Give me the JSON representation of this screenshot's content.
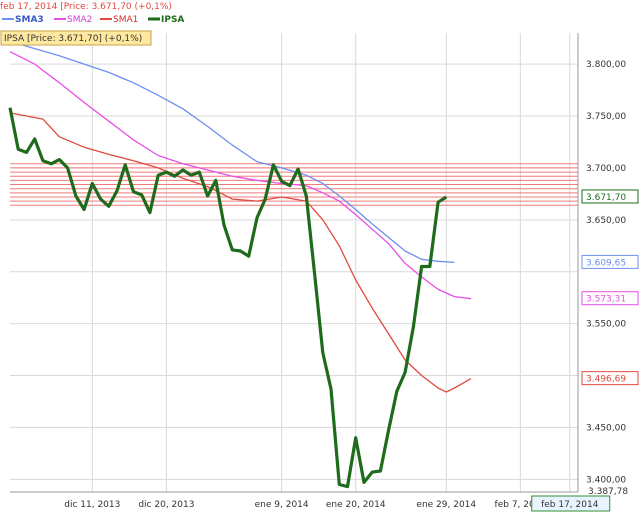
{
  "header": {
    "info_line": "feb 17, 2014 [Price: 3.671,70 (+0,1%)",
    "legend": [
      {
        "name": "SMA3",
        "color": "#6f8ff0"
      },
      {
        "name": "SMA2",
        "color": "#e64fe6"
      },
      {
        "name": "SMA1",
        "color": "#e04a3f"
      },
      {
        "name": "IPSA",
        "color": "#1f6b1c"
      }
    ],
    "price_box": "IPSA [Price: 3.671,70] (+0,1%)"
  },
  "colors": {
    "plot_bg": "#ffffff",
    "grid": "#d9d9d9",
    "band_lines": "#f07a7a",
    "axis_text": "#333333",
    "price_box_bg": "#ffe8a0"
  },
  "chart_data": {
    "type": "line",
    "x": [
      0,
      1,
      2,
      3,
      4,
      5,
      6,
      7,
      8,
      9,
      10,
      11,
      12,
      13,
      14,
      15,
      16,
      17,
      18,
      19,
      20,
      21,
      22,
      23,
      24,
      25,
      26,
      27,
      28,
      29,
      30,
      31,
      32,
      33,
      34,
      35,
      36,
      37,
      38,
      39,
      40,
      41,
      42,
      43,
      44,
      45,
      46,
      47,
      48,
      49,
      50,
      51,
      52,
      53,
      54,
      55,
      56,
      57,
      58,
      59,
      60,
      61,
      62,
      63,
      64,
      65,
      66,
      67,
      68,
      69
    ],
    "ylim": [
      3387.78,
      3830
    ],
    "yticks": [
      3400,
      3450,
      3500,
      3550,
      3600,
      3650,
      3700,
      3750,
      3800
    ],
    "ytick_labels": [
      "3.400,00",
      "3.450,00",
      "",
      "3.550,00",
      "",
      "3.650,00",
      "3.700,00",
      "3.750,00",
      "3.800,00"
    ],
    "xtick_labels": [
      {
        "pos": 10,
        "label": "dic 11, 2013"
      },
      {
        "pos": 19,
        "label": "dic 20, 2013"
      },
      {
        "pos": 33,
        "label": "ene 9, 2014"
      },
      {
        "pos": 42,
        "label": "ene 20, 2014"
      },
      {
        "pos": 53,
        "label": "ene 29, 2014"
      },
      {
        "pos": 62,
        "label": "feb 7, 2014"
      },
      {
        "pos": 68,
        "label": "feb 17, 2014"
      }
    ],
    "bottom_min_label": "3.387,78",
    "series": [
      {
        "name": "IPSA",
        "color": "#1f6b1c",
        "last_label": "3.671,70",
        "points": [
          [
            0,
            3758
          ],
          [
            1,
            3718
          ],
          [
            2,
            3715
          ],
          [
            3,
            3728
          ],
          [
            4,
            3707
          ],
          [
            5,
            3704
          ],
          [
            6,
            3708
          ],
          [
            7,
            3700
          ],
          [
            8,
            3673
          ],
          [
            9,
            3660
          ],
          [
            10,
            3685
          ],
          [
            11,
            3670
          ],
          [
            12,
            3663
          ],
          [
            13,
            3678
          ],
          [
            14,
            3703
          ],
          [
            15,
            3677
          ],
          [
            16,
            3674
          ],
          [
            17,
            3657
          ],
          [
            18,
            3693
          ],
          [
            19,
            3696
          ],
          [
            20,
            3692
          ],
          [
            21,
            3698
          ],
          [
            22,
            3693
          ],
          [
            23,
            3696
          ],
          [
            24,
            3673
          ],
          [
            25,
            3688
          ],
          [
            26,
            3645
          ],
          [
            27,
            3621
          ],
          [
            28,
            3620
          ],
          [
            29,
            3615
          ],
          [
            30,
            3652
          ],
          [
            31,
            3670
          ],
          [
            32,
            3703
          ],
          [
            33,
            3687
          ],
          [
            34,
            3683
          ],
          [
            35,
            3699
          ],
          [
            36,
            3673
          ],
          [
            37,
            3598
          ],
          [
            38,
            3522
          ],
          [
            39,
            3487
          ],
          [
            40,
            3395
          ],
          [
            41,
            3393
          ],
          [
            42,
            3440
          ],
          [
            43,
            3397
          ],
          [
            44,
            3407
          ],
          [
            45,
            3408
          ],
          [
            46,
            3448
          ],
          [
            47,
            3485
          ],
          [
            48,
            3503
          ],
          [
            49,
            3547
          ],
          [
            50,
            3605
          ],
          [
            51,
            3605
          ],
          [
            52,
            3667
          ],
          [
            53,
            3672
          ]
        ]
      },
      {
        "name": "SMA1",
        "color": "#e04a3f",
        "last_label": "3.496,69",
        "points": [
          [
            0,
            3753
          ],
          [
            4,
            3747
          ],
          [
            6,
            3730
          ],
          [
            9,
            3720
          ],
          [
            12,
            3713
          ],
          [
            15,
            3707
          ],
          [
            18,
            3700
          ],
          [
            21,
            3690
          ],
          [
            24,
            3682
          ],
          [
            27,
            3670
          ],
          [
            30,
            3668
          ],
          [
            33,
            3672
          ],
          [
            36,
            3668
          ],
          [
            38,
            3650
          ],
          [
            40,
            3625
          ],
          [
            42,
            3592
          ],
          [
            44,
            3565
          ],
          [
            46,
            3540
          ],
          [
            48,
            3515
          ],
          [
            50,
            3500
          ],
          [
            52,
            3488
          ],
          [
            53,
            3484
          ],
          [
            54,
            3488
          ],
          [
            56,
            3497
          ]
        ]
      },
      {
        "name": "SMA2",
        "color": "#e64fe6",
        "last_label": "3.573,31",
        "points": [
          [
            0,
            3812
          ],
          [
            3,
            3800
          ],
          [
            6,
            3782
          ],
          [
            9,
            3763
          ],
          [
            12,
            3745
          ],
          [
            15,
            3727
          ],
          [
            18,
            3712
          ],
          [
            21,
            3704
          ],
          [
            24,
            3698
          ],
          [
            27,
            3692
          ],
          [
            30,
            3688
          ],
          [
            33,
            3685
          ],
          [
            36,
            3683
          ],
          [
            38,
            3676
          ],
          [
            40,
            3668
          ],
          [
            42,
            3655
          ],
          [
            44,
            3641
          ],
          [
            46,
            3627
          ],
          [
            48,
            3608
          ],
          [
            50,
            3595
          ],
          [
            52,
            3583
          ],
          [
            54,
            3576
          ],
          [
            56,
            3574
          ]
        ]
      },
      {
        "name": "SMA3",
        "color": "#6f8ff0",
        "last_label": "3.609,65",
        "points": [
          [
            0,
            3822
          ],
          [
            3,
            3815
          ],
          [
            6,
            3808
          ],
          [
            9,
            3800
          ],
          [
            12,
            3792
          ],
          [
            15,
            3782
          ],
          [
            18,
            3770
          ],
          [
            21,
            3757
          ],
          [
            24,
            3740
          ],
          [
            27,
            3722
          ],
          [
            30,
            3706
          ],
          [
            33,
            3700
          ],
          [
            36,
            3693
          ],
          [
            38,
            3685
          ],
          [
            40,
            3673
          ],
          [
            42,
            3660
          ],
          [
            44,
            3646
          ],
          [
            46,
            3633
          ],
          [
            48,
            3620
          ],
          [
            50,
            3612
          ],
          [
            52,
            3610
          ],
          [
            54,
            3609
          ]
        ]
      }
    ],
    "bands": [
      3664,
      3668,
      3672,
      3676,
      3680,
      3684,
      3688,
      3692,
      3696,
      3700,
      3704
    ]
  }
}
